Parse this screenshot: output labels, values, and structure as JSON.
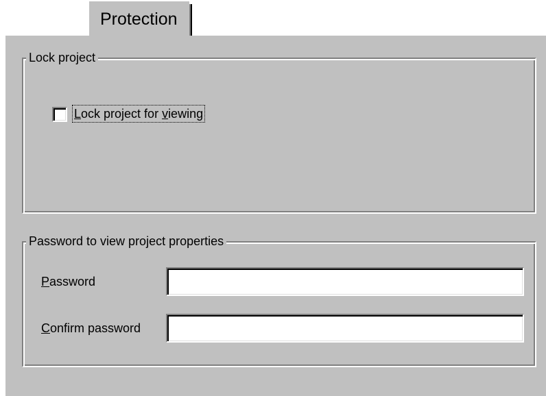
{
  "tab": {
    "label": "Protection"
  },
  "lock_group": {
    "title": "Lock project",
    "checkbox": {
      "label_prefix": "",
      "label_mnemonic": "L",
      "label_mid": "ock project for ",
      "label_mnemonic2": "v",
      "label_suffix": "iewing",
      "checked": false
    }
  },
  "password_group": {
    "title": "Password to view project properties",
    "password": {
      "label_mnemonic": "P",
      "label_rest": "assword",
      "value": ""
    },
    "confirm": {
      "label_mnemonic": "C",
      "label_rest": "onfirm password",
      "value": ""
    }
  },
  "colors": {
    "face": "#c0c0c0",
    "highlight": "#ffffff",
    "shadow": "#808080",
    "dark_shadow": "#000000",
    "field": "#ffffff"
  }
}
